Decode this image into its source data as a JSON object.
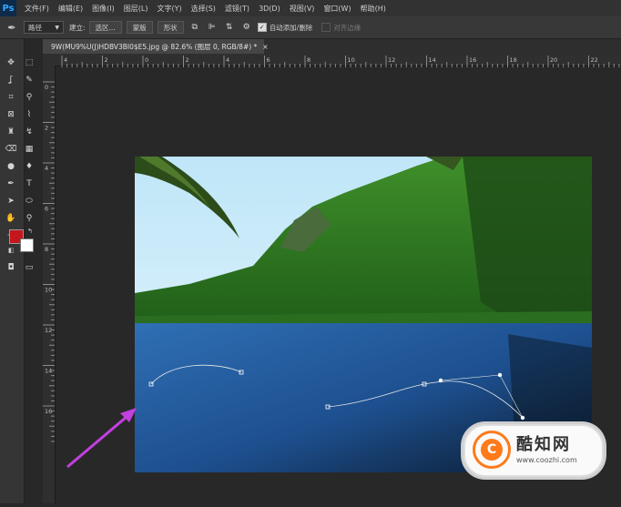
{
  "app": {
    "logo": "Ps"
  },
  "menu": [
    "文件(F)",
    "编辑(E)",
    "图像(I)",
    "图层(L)",
    "文字(Y)",
    "选择(S)",
    "滤镜(T)",
    "3D(D)",
    "视图(V)",
    "窗口(W)",
    "帮助(H)"
  ],
  "options": {
    "tool_icon": "pen-icon",
    "mode_value": "路径",
    "make_label": "建立:",
    "selection_button": "选区...",
    "mask_button": "蒙版",
    "shape_button": "形状",
    "auto_add_delete": "自动添加/删除",
    "align_edges": "对齐边缘"
  },
  "document": {
    "tab_title": "9W(MU9%U(J)HDBV3BI0$E5.jpg @ 82.6% (图层 0, RGB/8#) *",
    "close_label": "×"
  },
  "rulers": {
    "h_ticks": [
      "4",
      "2",
      "0",
      "2",
      "4",
      "6",
      "8",
      "10",
      "12",
      "14",
      "16",
      "18",
      "20",
      "22"
    ],
    "v_ticks": [
      "0",
      "2",
      "4",
      "6",
      "8",
      "10",
      "12",
      "14",
      "16"
    ]
  },
  "colors": {
    "foreground": "#c4161c",
    "background": "#ffffff",
    "path_arrow": "#c040e0"
  },
  "watermark": {
    "title": "酷知网",
    "url": "www.coozhi.com",
    "logo_letter": "C"
  }
}
